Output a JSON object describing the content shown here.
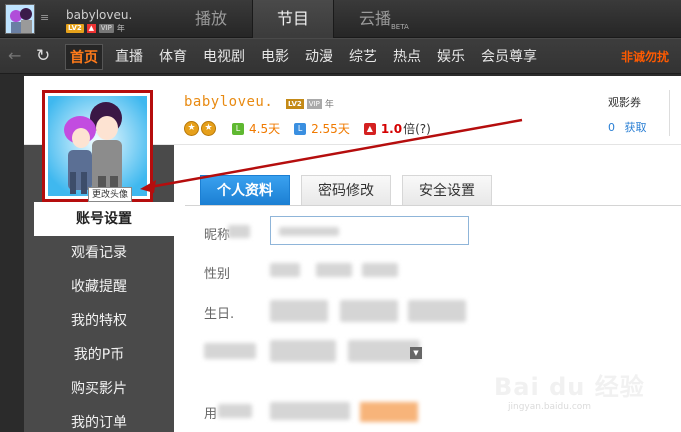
{
  "topbar": {
    "username": "babyloveu.",
    "badges": {
      "level": "LV2",
      "vip": "VIP",
      "year": "年"
    },
    "tabs": [
      {
        "label": "播放",
        "active": false
      },
      {
        "label": "节目",
        "active": true
      },
      {
        "label": "云播",
        "badge": "BETA",
        "active": false
      }
    ]
  },
  "navbar": {
    "items": [
      {
        "label": "首页",
        "active": true
      },
      {
        "label": "直播"
      },
      {
        "label": "体育"
      },
      {
        "label": "电视剧"
      },
      {
        "label": "电影"
      },
      {
        "label": "动漫"
      },
      {
        "label": "综艺"
      },
      {
        "label": "热点"
      },
      {
        "label": "娱乐"
      },
      {
        "label": "会员尊享"
      }
    ],
    "notice": "非诚勿扰"
  },
  "profile": {
    "username": "babyloveu.",
    "level": "LV2",
    "vip": "VIP",
    "year": "年",
    "change_avatar": "更改头像",
    "stats": [
      {
        "icon": "calendar-green-icon",
        "value": "4.5天"
      },
      {
        "icon": "calendar-blue-icon",
        "value": "2.55天"
      },
      {
        "icon": "speed-up-icon",
        "value": "1.0",
        "unit": "倍(?)"
      }
    ],
    "coupon_label": "观影券",
    "coupon_value": "0",
    "coupon_link": "获取"
  },
  "sidebar": {
    "items": [
      {
        "label": "账号设置",
        "active": true
      },
      {
        "label": "观看记录"
      },
      {
        "label": "收藏提醒"
      },
      {
        "label": "我的特权"
      },
      {
        "label": "我的P币"
      },
      {
        "label": "购买影片"
      },
      {
        "label": "我的订单"
      }
    ]
  },
  "tabs": [
    {
      "label": "个人资料",
      "active": true
    },
    {
      "label": "密码修改"
    },
    {
      "label": "安全设置"
    }
  ],
  "form": {
    "nickname_label": "昵称",
    "gender_label": "性别",
    "birthday_label": "生日.",
    "username_label": "用"
  },
  "watermark": {
    "logo": "Bai du 经验",
    "sub": "jingyan.baidu.com"
  },
  "colors": {
    "accent_orange": "#ff7a1a",
    "tab_blue": "#1b7fd3",
    "highlight_red": "#b50d0d"
  }
}
